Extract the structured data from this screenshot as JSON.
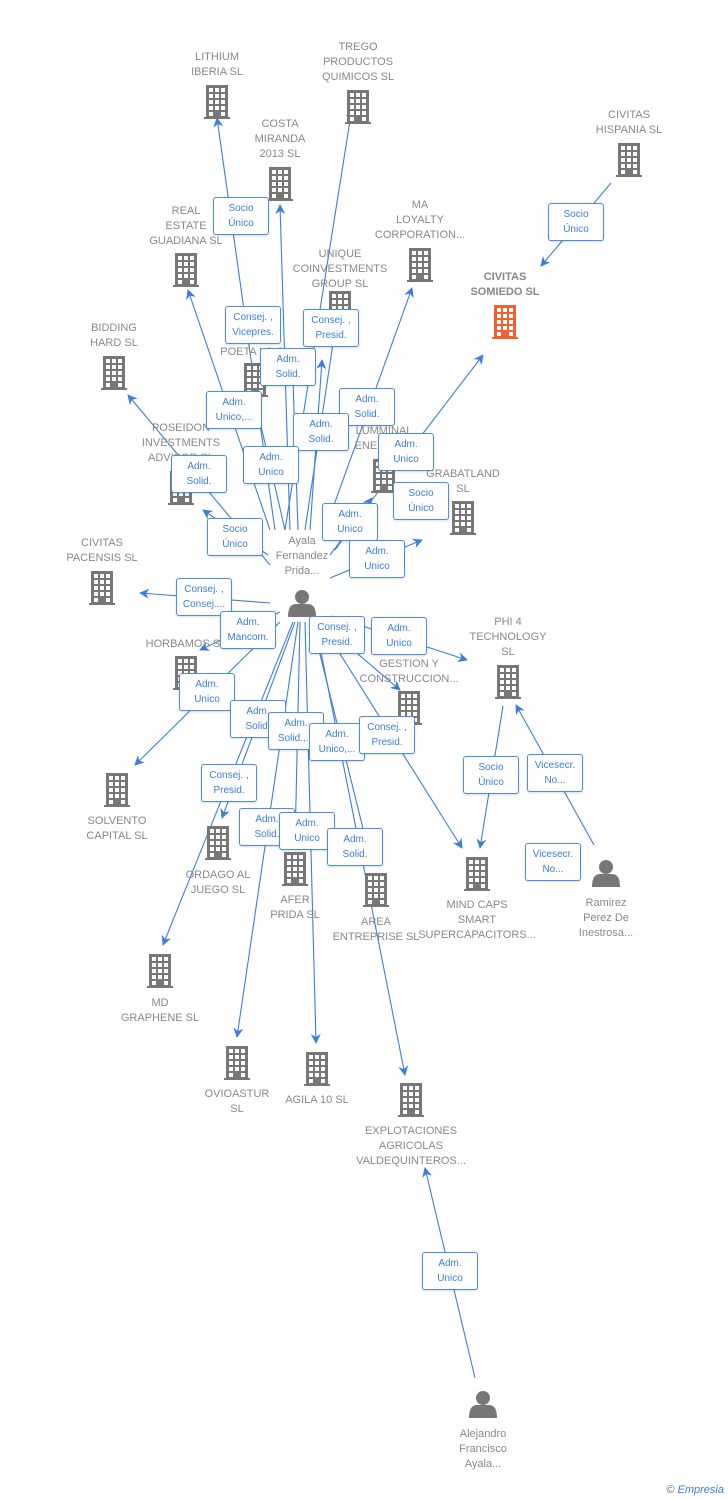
{
  "colors": {
    "edge": "#3a7fd8",
    "building": "#777777",
    "highlight": "#f06030",
    "label": "#888888"
  },
  "nodes": {
    "lithium": {
      "type": "company",
      "lines": [
        "LITHIUM",
        "IBERIA  SL"
      ]
    },
    "trego": {
      "type": "company",
      "lines": [
        "TREGO",
        "PRODUCTOS",
        "QUIMICOS  SL"
      ]
    },
    "costa": {
      "type": "company",
      "lines": [
        "COSTA",
        "MIRANDA",
        "2013  SL"
      ]
    },
    "civitas_hispania": {
      "type": "company",
      "lines": [
        "CIVITAS",
        "HISPANIA  SL"
      ]
    },
    "real_estate": {
      "type": "company",
      "lines": [
        "REAL",
        "ESTATE",
        "GUADIANA  SL"
      ]
    },
    "ma_loyalty": {
      "type": "company",
      "lines": [
        "MA",
        "LOYALTY",
        "CORPORATION..."
      ]
    },
    "unique": {
      "type": "company",
      "lines": [
        "UNIQUE",
        "COINVESTMENTS",
        "GROUP  SL"
      ]
    },
    "civitas_somiedo": {
      "type": "company-highlight",
      "lines": [
        "CIVITAS",
        "SOMIEDO  SL"
      ]
    },
    "bidding": {
      "type": "company",
      "lines": [
        "BIDDING",
        "HARD  SL"
      ]
    },
    "poeta": {
      "type": "company",
      "lines": [
        "POETA LC  SL"
      ]
    },
    "poseidon": {
      "type": "company",
      "lines": [
        "POSEIDON",
        "INVESTMENTS",
        "ADVISOR  SL"
      ]
    },
    "lumminal": {
      "type": "company",
      "lines": [
        "LUMMINAL",
        "ENERGIA..."
      ]
    },
    "grabatland": {
      "type": "company",
      "lines": [
        "GRABATLAND",
        "SL"
      ]
    },
    "ayala": {
      "type": "person",
      "lines": [
        "Ayala",
        "Fernandez",
        "Prida..."
      ]
    },
    "civitas_pacensis": {
      "type": "company",
      "lines": [
        "CIVITAS",
        "PACENSIS  SL"
      ]
    },
    "horbamos": {
      "type": "company",
      "lines": [
        "HORBAMOS  SL"
      ]
    },
    "phi4": {
      "type": "company",
      "lines": [
        "PHI 4",
        "TECHNOLOGY",
        "SL"
      ]
    },
    "gestion": {
      "type": "company",
      "lines": [
        "...A",
        "GESTION Y",
        "CONSTRUCCION..."
      ]
    },
    "solvento": {
      "type": "company",
      "lines": [
        "SOLVENTO",
        "CAPITAL SL"
      ]
    },
    "ordago": {
      "type": "company",
      "lines": [
        "ORDAGO AL",
        "JUEGO  SL"
      ]
    },
    "afer": {
      "type": "company",
      "lines": [
        "AFER",
        "PRIDA  SL"
      ]
    },
    "area": {
      "type": "company",
      "lines": [
        "AREA",
        "ENTREPRISE SL"
      ]
    },
    "mindcaps": {
      "type": "company",
      "lines": [
        "MIND CAPS",
        "SMART",
        "SUPERCAPACITORS..."
      ]
    },
    "ramirez": {
      "type": "person",
      "lines": [
        "Ramirez",
        "Perez De",
        "Inestrosa..."
      ]
    },
    "md_graphene": {
      "type": "company",
      "lines": [
        "MD",
        "GRAPHENE  SL"
      ]
    },
    "ovioastur": {
      "type": "company",
      "lines": [
        "OVIOASTUR",
        "SL"
      ]
    },
    "agila": {
      "type": "company",
      "lines": [
        "AGILA 10  SL"
      ]
    },
    "explotaciones": {
      "type": "company",
      "lines": [
        "EXPLOTACIONES",
        "AGRICOLAS",
        "VALDEQUINTEROS..."
      ]
    },
    "alejandro": {
      "type": "person",
      "lines": [
        "Alejandro",
        "Francisco",
        "Ayala..."
      ]
    }
  },
  "roles": [
    [
      "Socio",
      "Único"
    ],
    [
      "Consej. ,",
      "Vicepres."
    ],
    [
      "Adm.",
      "Solid."
    ],
    [
      "Consej. ,",
      "Presid."
    ],
    [
      "Adm.",
      "Unico,..."
    ],
    [
      "Adm.",
      "Solid."
    ],
    [
      "Adm.",
      "Solid."
    ],
    [
      "Adm.",
      "Unico"
    ],
    [
      "Adm.",
      "Solid."
    ],
    [
      "Adm.",
      "Unico"
    ],
    [
      "Socio",
      "Único"
    ],
    [
      "Socio",
      "Único"
    ],
    [
      "Adm.",
      "Unico"
    ],
    [
      "Adm.",
      "Unico"
    ],
    [
      "Socio",
      "Único"
    ],
    [
      "Consej. ,",
      "Consej...."
    ],
    [
      "Adm.",
      "Mancom."
    ],
    [
      "Adm.",
      "Unico"
    ],
    [
      "Adm.",
      "Unico"
    ],
    [
      "Consej. ,",
      "Presid."
    ],
    [
      "Adm.",
      "Solid."
    ],
    [
      "Adm.",
      "Solid.,..."
    ],
    [
      "Adm.",
      "Unico,..."
    ],
    [
      "Consej. ,",
      "Presid."
    ],
    [
      "Consej. ,",
      "Presid."
    ],
    [
      "Adm.",
      "Solid."
    ],
    [
      "Adm.",
      "Unico"
    ],
    [
      "Adm.",
      "Solid."
    ],
    [
      "Socio",
      "Único"
    ],
    [
      "Vicesecr.",
      "No..."
    ],
    [
      "Vicesecr.",
      "No..."
    ],
    [
      "Adm.",
      "Unico"
    ]
  ],
  "brand": {
    "copyright": "©",
    "name": "Empresia"
  }
}
